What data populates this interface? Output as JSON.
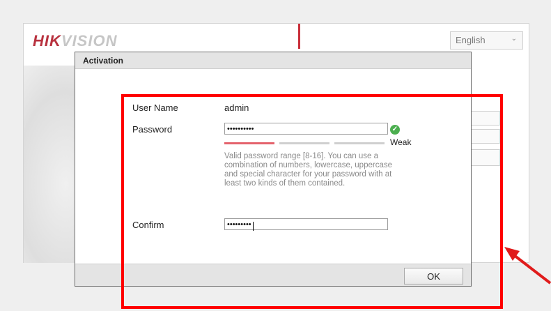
{
  "app": {
    "brand": {
      "part1": "HIK",
      "part2": "VISION"
    },
    "language": {
      "selected": "English",
      "chevron": "⌄"
    }
  },
  "dialog": {
    "title": "Activation",
    "user_name": {
      "label": "User Name",
      "value": "admin"
    },
    "password": {
      "label": "Password",
      "value": "••••••••••",
      "strength_label": "Weak",
      "strength_level": 1,
      "strength_levels": 3,
      "valid_icon": "check-circle-icon",
      "hint": "Valid password range [8-16]. You can use a combination of numbers, lowercase, uppercase and special character for your password with at least two kinds of them contained."
    },
    "confirm": {
      "label": "Confirm",
      "value": "•••••••••"
    },
    "ok_label": "OK"
  },
  "colors": {
    "brand_red": "#b8323f",
    "strength_weak": "#e4636c",
    "valid_green": "#4caf50",
    "annotation_red": "#ff0000"
  },
  "annotations": {
    "highlight_box": "red-rectangle",
    "pointer": "red-arrow"
  }
}
